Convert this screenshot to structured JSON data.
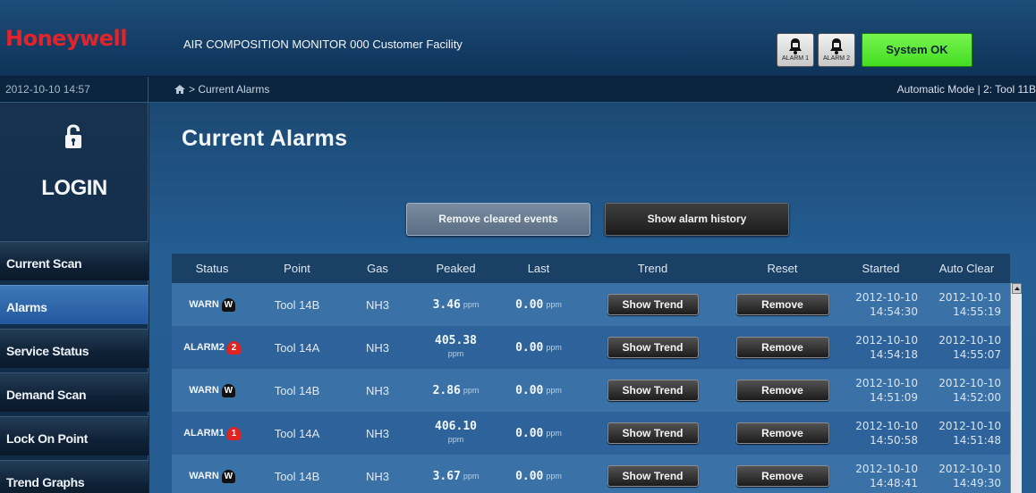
{
  "header": {
    "logo": "Honeywell",
    "title": "AIR COMPOSITION MONITOR 000 Customer Facility",
    "alarm1_label": "ALARM 1",
    "alarm2_label": "ALARM 2",
    "status": "System OK",
    "status_color": "#44dd22"
  },
  "subbar": {
    "datetime": "2012-10-10 14:57",
    "breadcrumb": "> Current Alarms",
    "mode": "Automatic Mode | 2: Tool 11B"
  },
  "sidebar": {
    "login": "LOGIN",
    "items": [
      {
        "label": "Current Scan",
        "active": false
      },
      {
        "label": "Alarms",
        "active": true
      },
      {
        "label": "Service Status",
        "active": false
      },
      {
        "label": "Demand Scan",
        "active": false
      },
      {
        "label": "Lock On Point",
        "active": false
      },
      {
        "label": "Trend Graphs",
        "active": false
      }
    ]
  },
  "main": {
    "title": "Current Alarms",
    "remove_cleared_label": "Remove cleared events",
    "show_history_label": "Show alarm history",
    "columns": [
      "Status",
      "Point",
      "Gas",
      "Peaked",
      "Last",
      "Trend",
      "Reset",
      "Started",
      "Auto Clear"
    ],
    "rows": [
      {
        "status": "WARN",
        "badge": "W",
        "badge_type": "w",
        "point": "Tool 14B",
        "gas": "NH3",
        "peaked": "3.46",
        "peaked_unit": "ppm",
        "peaked_stacked": false,
        "last": "0.00",
        "last_unit": "ppm",
        "trend": "Show Trend",
        "reset": "Remove",
        "started_date": "2012-10-10",
        "started_time": "14:54:30",
        "clear_date": "2012-10-10",
        "clear_time": "14:55:19"
      },
      {
        "status": "ALARM2",
        "badge": "2",
        "badge_type": "r",
        "point": "Tool 14A",
        "gas": "NH3",
        "peaked": "405.38",
        "peaked_unit": "ppm",
        "peaked_stacked": true,
        "last": "0.00",
        "last_unit": "ppm",
        "trend": "Show Trend",
        "reset": "Remove",
        "started_date": "2012-10-10",
        "started_time": "14:54:18",
        "clear_date": "2012-10-10",
        "clear_time": "14:55:07"
      },
      {
        "status": "WARN",
        "badge": "W",
        "badge_type": "w",
        "point": "Tool 14B",
        "gas": "NH3",
        "peaked": "2.86",
        "peaked_unit": "ppm",
        "peaked_stacked": false,
        "last": "0.00",
        "last_unit": "ppm",
        "trend": "Show Trend",
        "reset": "Remove",
        "started_date": "2012-10-10",
        "started_time": "14:51:09",
        "clear_date": "2012-10-10",
        "clear_time": "14:52:00"
      },
      {
        "status": "ALARM1",
        "badge": "1",
        "badge_type": "r",
        "point": "Tool 14A",
        "gas": "NH3",
        "peaked": "406.10",
        "peaked_unit": "ppm",
        "peaked_stacked": true,
        "last": "0.00",
        "last_unit": "ppm",
        "trend": "Show Trend",
        "reset": "Remove",
        "started_date": "2012-10-10",
        "started_time": "14:50:58",
        "clear_date": "2012-10-10",
        "clear_time": "14:51:48"
      },
      {
        "status": "WARN",
        "badge": "W",
        "badge_type": "w",
        "point": "Tool 14B",
        "gas": "NH3",
        "peaked": "3.67",
        "peaked_unit": "ppm",
        "peaked_stacked": false,
        "last": "0.00",
        "last_unit": "ppm",
        "trend": "Show Trend",
        "reset": "Remove",
        "started_date": "2012-10-10",
        "started_time": "14:48:41",
        "clear_date": "2012-10-10",
        "clear_time": "14:49:30"
      }
    ]
  }
}
